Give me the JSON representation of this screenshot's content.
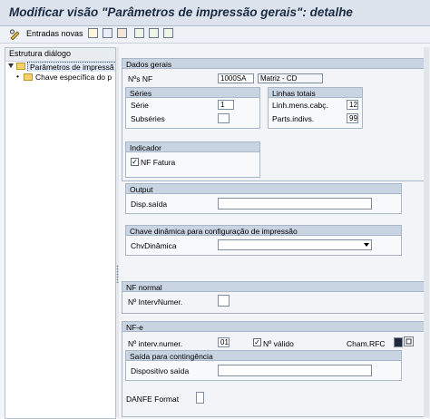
{
  "window": {
    "title": "Modificar visão \"Parâmetros de impressão gerais\": detalhe"
  },
  "toolbar": {
    "new_entries": "Entradas novas"
  },
  "tree": {
    "header": "Estrutura diálogo",
    "items": [
      {
        "label": "Parâmetros de impressã"
      },
      {
        "label": "Chave específica do p"
      }
    ]
  },
  "form": {
    "dados_gerais": {
      "header": "Dados gerais",
      "nf_label": "Nºs NF",
      "nf_value": "1000SA",
      "nf_desc": "Matriz - CD"
    },
    "series": {
      "header": "Séries",
      "serie_label": "Série",
      "serie_value": "1",
      "subseries_label": "Subséries",
      "subseries_value": ""
    },
    "linhas": {
      "header": "Linhas totais",
      "cabc_label": "Linh.mens.cabç.",
      "cabc_value": "12",
      "parts_label": "Parts.indivs.",
      "parts_value": "99"
    },
    "indicador": {
      "header": "Indicador",
      "nf_fatura_label": "NF Fatura",
      "nf_fatura_checked": "✓"
    },
    "output": {
      "header": "Output",
      "disp_label": "Disp.saída",
      "disp_value": ""
    },
    "chave": {
      "header": "Chave dinâmica para configuração de impressão",
      "chv_label": "ChvDinâmica",
      "chv_value": ""
    },
    "nf_normal": {
      "header": "NF normal",
      "interv_label": "Nº IntervNumer.",
      "interv_value": ""
    },
    "nfe": {
      "header": "NF-e",
      "interv_label": "Nº interv.numer.",
      "interv_value": "01",
      "valido_label": "Nº válido",
      "valido_checked": "✓",
      "rfc_label": "Cham.RFC",
      "contingencia_header": "Saída para contingência",
      "disp_label": "Dispositivo saída",
      "disp_value": "",
      "danfe_label": "DANFE Format",
      "danfe_value": ""
    }
  }
}
